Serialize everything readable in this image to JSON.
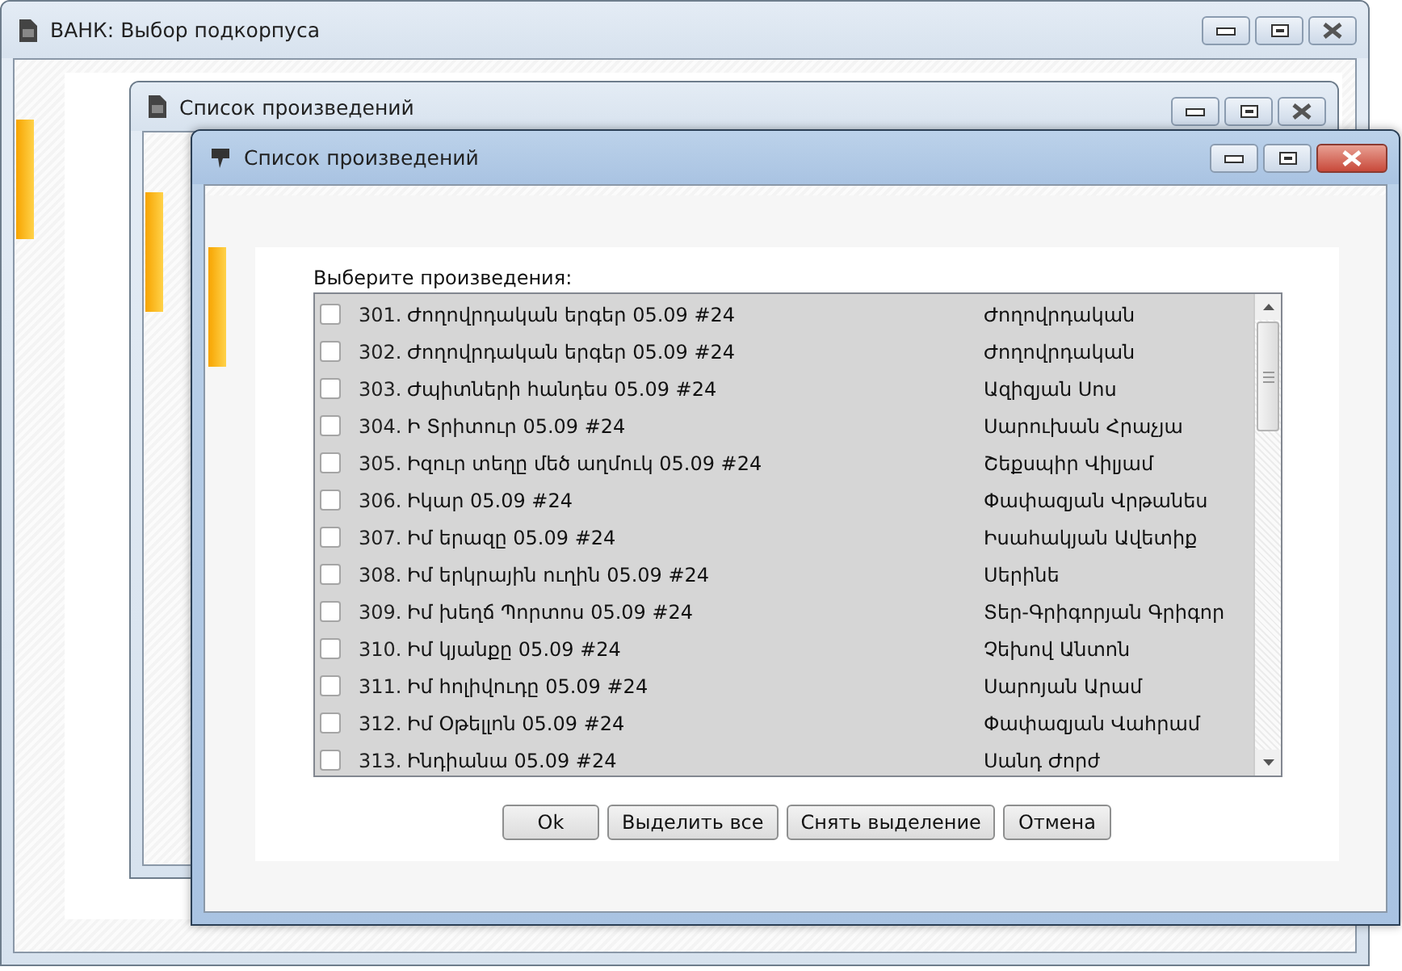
{
  "windows": [
    {
      "title": "ВАНК: Выбор подкорпуса",
      "active": false
    },
    {
      "title": "Список произведений",
      "active": false
    },
    {
      "title": "Список произведений",
      "active": true
    }
  ],
  "dialog": {
    "prompt": "Выберите произведения:",
    "rows": [
      {
        "number": "301.",
        "title": "Ժողովրդական երգեր 05.09 #24",
        "author": "Ժողովրդական",
        "checked": false
      },
      {
        "number": "302.",
        "title": "Ժողովրդական երգեր 05.09 #24",
        "author": "Ժողովրդական",
        "checked": false
      },
      {
        "number": "303.",
        "title": "Ժպիտների հանդես 05.09 #24",
        "author": "Ազիզյան Սոս",
        "checked": false
      },
      {
        "number": "304.",
        "title": "Ի Տրիտուր 05.09 #24",
        "author": "Սարուխան Հրաչյա",
        "checked": false
      },
      {
        "number": "305.",
        "title": "Իզուր տեղը մեծ աղմուկ 05.09 #24",
        "author": "Շեքսպիր Վիլյամ",
        "checked": false
      },
      {
        "number": "306.",
        "title": "Իկար 05.09 #24",
        "author": "Փափազյան Վրթանես",
        "checked": false
      },
      {
        "number": "307.",
        "title": "Իմ երազը 05.09 #24",
        "author": "Իսահակյան Ավետիք",
        "checked": false
      },
      {
        "number": "308.",
        "title": "Իմ երկրային ուղին 05.09 #24",
        "author": "Սերինե",
        "checked": false
      },
      {
        "number": "309.",
        "title": "Իմ խեղճ Պորտոս 05.09 #24",
        "author": "Տեր-Գրիգորյան Գրիգոր",
        "checked": false
      },
      {
        "number": "310.",
        "title": "Իմ կյանքը 05.09 #24",
        "author": "Չեխով Անտոն",
        "checked": false
      },
      {
        "number": "311.",
        "title": "Իմ հոլիվուդը 05.09 #24",
        "author": "Սարոյան Արամ",
        "checked": false
      },
      {
        "number": "312.",
        "title": "Իմ Օթելլոն 05.09 #24",
        "author": "Փափազյան Վահրամ",
        "checked": false
      },
      {
        "number": "313.",
        "title": "Ինդիանա 05.09 #24",
        "author": "Սանդ Ժորժ",
        "checked": false
      }
    ],
    "buttons": [
      "Ok",
      "Выделить все",
      "Снять выделение",
      "Отмена"
    ]
  }
}
